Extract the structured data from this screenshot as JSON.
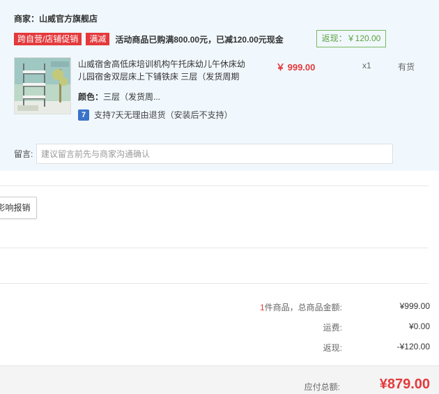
{
  "shop": {
    "name": "商家：山威官方旗舰店",
    "tag_cross_store": "跨自营/店铺促销",
    "tag_full_reduction": "满减",
    "promo_text": "活动商品已购满800.00元，已减120.00元现金",
    "rebate": "返现：￥120.00"
  },
  "product": {
    "title": "山威宿舍高低床培训机构午托床幼儿午休床幼儿园宿舍双层床上下铺铁床 三层（发货周期",
    "price": "￥ 999.00",
    "quantity": "x1",
    "stock": "有货",
    "color_label": "颜色：",
    "color_value": "三层（发货周...",
    "return_icon": "7",
    "return_policy": "支持7天无理由退货（安装后不支持）"
  },
  "memo": {
    "label": "留言:",
    "placeholder": "建议留言前先与商家沟通确认"
  },
  "reimburse": {
    "button_label": "影响报销"
  },
  "summary": {
    "item_count": "1",
    "item_count_suffix": "件商品，总商品金额:",
    "goods_total": "¥999.00",
    "shipping_label": "运费:",
    "shipping_value": "¥0.00",
    "rebate_label": "返现:",
    "rebate_value": "-¥120.00"
  },
  "total": {
    "label": "应付总额:",
    "value": "¥879.00"
  },
  "colors": {
    "accent_red": "#e4393c",
    "panel_bg": "#f1f8fd",
    "rebate_green": "#5ba23f"
  }
}
